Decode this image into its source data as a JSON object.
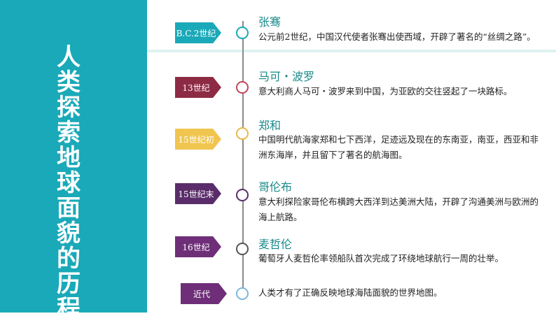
{
  "sidebar": {
    "title_chars": [
      "人",
      "类",
      "探",
      "索",
      "地",
      "球",
      "面",
      "貌",
      "的",
      "历",
      "程"
    ],
    "color": "#1aa9b8"
  },
  "events": [
    {
      "era": "B.C.2世纪",
      "name": "张骞",
      "description": "公元前2世纪，中国汉代使者张骞出使西域，开辟了著名的“丝绸之路”。",
      "badge_color": "#1aa9b8",
      "node_color": "#1aa9b8"
    },
    {
      "era": "13世纪",
      "name": "马可・波罗",
      "description": "意大利商人马可・波罗来到中国，为亚欧的交往竖起了一块路标。",
      "badge_color": "#8e2b44",
      "node_color": "#c0475c"
    },
    {
      "era": "15世纪初",
      "name": "郑和",
      "description": "中国明代航海家郑和七下西洋，足迹远及现在的东南亚，南亚，西亚和非洲东海岸，并且留下了著名的航海图。",
      "badge_color": "#f0c550",
      "node_color": "#e8b84a"
    },
    {
      "era": "15世纪末",
      "name": "哥伦布",
      "description": "意大利探险家哥伦布横跨大西洋到达美洲大陆，开辟了沟通美洲与欧洲的海上航路。",
      "badge_color": "#5a2d6a",
      "node_color": "#5a2d6a"
    },
    {
      "era": "16世纪",
      "name": "麦哲伦",
      "description": "葡萄牙人麦哲伦率领船队首次完成了环绕地球航行一周的壮举。",
      "badge_color": "#6e2f78",
      "node_color": "#555555"
    },
    {
      "era": "近代",
      "name": "",
      "description": "人类才有了正确反映地球海陆面貌的世界地图。",
      "badge_color": "#6e2f78",
      "node_color": "#7fb8d8"
    }
  ]
}
